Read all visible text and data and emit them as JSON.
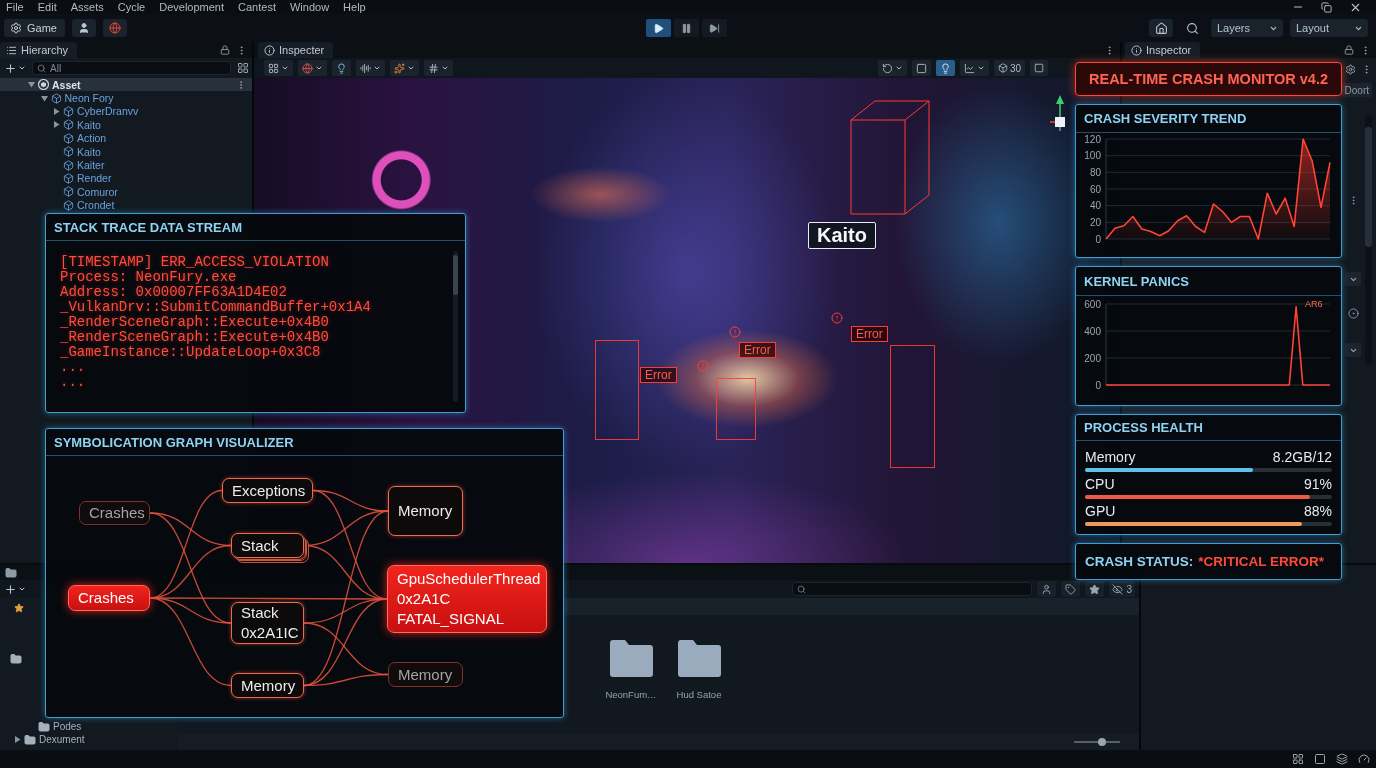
{
  "menu": [
    "File",
    "Edit",
    "Assets",
    "Cycle",
    "Development",
    "Cantest",
    "Window",
    "Help"
  ],
  "toolbar": {
    "game_button": "Game",
    "playback": [
      {
        "kind": "play",
        "selected": true
      },
      {
        "kind": "pause",
        "selected": false
      },
      {
        "kind": "step",
        "selected": false
      }
    ],
    "layers": "Layers",
    "layout": "Layout"
  },
  "hierarchy": {
    "tab": "Hierarchy",
    "search": {
      "placeholder": "All"
    },
    "tree": [
      {
        "label": "Asset",
        "kind": "scene",
        "selected": true,
        "expanded": true,
        "children": [
          {
            "label": "Neon Fory",
            "kind": "prefab",
            "selected": false,
            "expanded": true,
            "children": [
              {
                "label": "CyberDranvv",
                "kind": "prefab",
                "selected": false,
                "expanded": false
              },
              {
                "label": "Kaito",
                "kind": "prefab",
                "selected": false,
                "expanded": false
              },
              {
                "label": "Action",
                "kind": "prefab",
                "selected": false
              },
              {
                "label": "Kaito",
                "kind": "prefab",
                "selected": false
              },
              {
                "label": "Kaiter",
                "kind": "prefab",
                "selected": false
              },
              {
                "label": "Render",
                "kind": "prefab",
                "selected": false
              },
              {
                "label": "Comuror",
                "kind": "prefab",
                "selected": false
              },
              {
                "label": "Crondet",
                "kind": "prefab",
                "selected": false
              }
            ]
          }
        ]
      }
    ]
  },
  "scene": {
    "tab": "Inspecter",
    "toolbar": {
      "lighting_on": true,
      "mode_label": "30"
    },
    "overlays": [
      {
        "kind": "name_tag",
        "text": "Kaito"
      },
      {
        "kind": "error",
        "text": "Error"
      },
      {
        "kind": "error",
        "text": "Error"
      },
      {
        "kind": "error",
        "text": "Error"
      }
    ]
  },
  "inspector": {
    "tab": "Inspector",
    "button": "Doort"
  },
  "stack_trace": {
    "title": "STACK TRACE DATA STREAM",
    "lines": [
      "[TIMESTAMP] ERR_ACCESS_VIOLATION",
      "Process: NeonFury.exe",
      "Address: 0x00007FF63A1D4E02",
      "_VulkanDrv::SubmitCommandBuffer+0x1A4",
      "_RenderSceneGraph::Execute+0x4B0",
      "_RenderSceneGraph::Execute+0x4B0",
      "_GameInstance::UpdateLoop+0x3C8",
      "...",
      "..."
    ]
  },
  "graph": {
    "title": "SYMBOLICATION GRAPH VISUALIZER",
    "nodes": [
      {
        "lines": [
          "Crashes"
        ],
        "kind": "dim",
        "stacked": false
      },
      {
        "lines": [
          "Exceptions"
        ],
        "kind": "normal",
        "stacked": false
      },
      {
        "lines": [
          "Stack"
        ],
        "kind": "normal",
        "stacked": true
      },
      {
        "lines": [
          "Memory"
        ],
        "kind": "normal",
        "stacked": false
      },
      {
        "lines": [
          "Crashes"
        ],
        "kind": "alert",
        "stacked": false
      },
      {
        "lines": [
          "Stack",
          "0x2A1IC"
        ],
        "kind": "normal",
        "stacked": false
      },
      {
        "lines": [
          "GpuSchedulerThread",
          "0x2A1C",
          "FATAL_SIGNAL"
        ],
        "kind": "alert",
        "stacked": false
      },
      {
        "lines": [
          "Memory"
        ],
        "kind": "normal",
        "stacked": false
      },
      {
        "lines": [
          "Memory"
        ],
        "kind": "dim",
        "stacked": false
      }
    ]
  },
  "monitor": {
    "title": "REAL-TIME CRASH MONITOR v4.2",
    "severity": {
      "chart_data": {
        "type": "area",
        "title": "CRASH SEVERITY TREND",
        "values": [
          0,
          13,
          16,
          27,
          12,
          9,
          4,
          10,
          22,
          28,
          15,
          8,
          42,
          33,
          20,
          27,
          27,
          0,
          55,
          30,
          49,
          15,
          120,
          94,
          38,
          92
        ],
        "ylim": [
          0,
          120
        ],
        "yticks": [
          0,
          20,
          40,
          60,
          80,
          100,
          120
        ],
        "grid": true
      }
    },
    "kernel": {
      "chart_data": {
        "type": "line",
        "title": "KERNEL PANICS",
        "values": [
          0,
          0,
          0,
          0,
          0,
          0,
          0,
          0,
          0,
          0,
          0,
          0,
          0,
          0,
          0,
          0,
          0,
          0,
          0,
          0,
          0,
          0,
          0,
          0,
          0,
          0,
          0,
          0,
          580,
          0,
          0,
          0,
          0,
          0
        ],
        "ylim": [
          0,
          600
        ],
        "yticks": [
          0,
          200,
          400,
          600
        ],
        "grid": true,
        "annotations": [
          "AR6"
        ]
      }
    },
    "health": {
      "title": "PROCESS HEALTH",
      "metrics": [
        {
          "label": "Memory",
          "reading": "8.2GB/12",
          "level": 0.68,
          "color": "#5bc3ea"
        },
        {
          "label": "CPU",
          "reading": "91%",
          "level": 0.91,
          "color": "#ee5a45"
        },
        {
          "label": "GPU",
          "reading": "88%",
          "level": 0.88,
          "color": "#f29a55"
        }
      ]
    },
    "status": {
      "label": "CRASH STATUS:",
      "value": "*CRITICAL ERROR*"
    }
  },
  "project": {
    "tree": [
      {
        "label": "Podes"
      },
      {
        "label": "Dexument",
        "expanded": false
      }
    ],
    "folders": [
      {
        "label": "NeonFum…"
      },
      {
        "label": "Hud Satoe"
      }
    ],
    "hidden_count": "3",
    "zoom": {
      "level": 0.6
    }
  }
}
